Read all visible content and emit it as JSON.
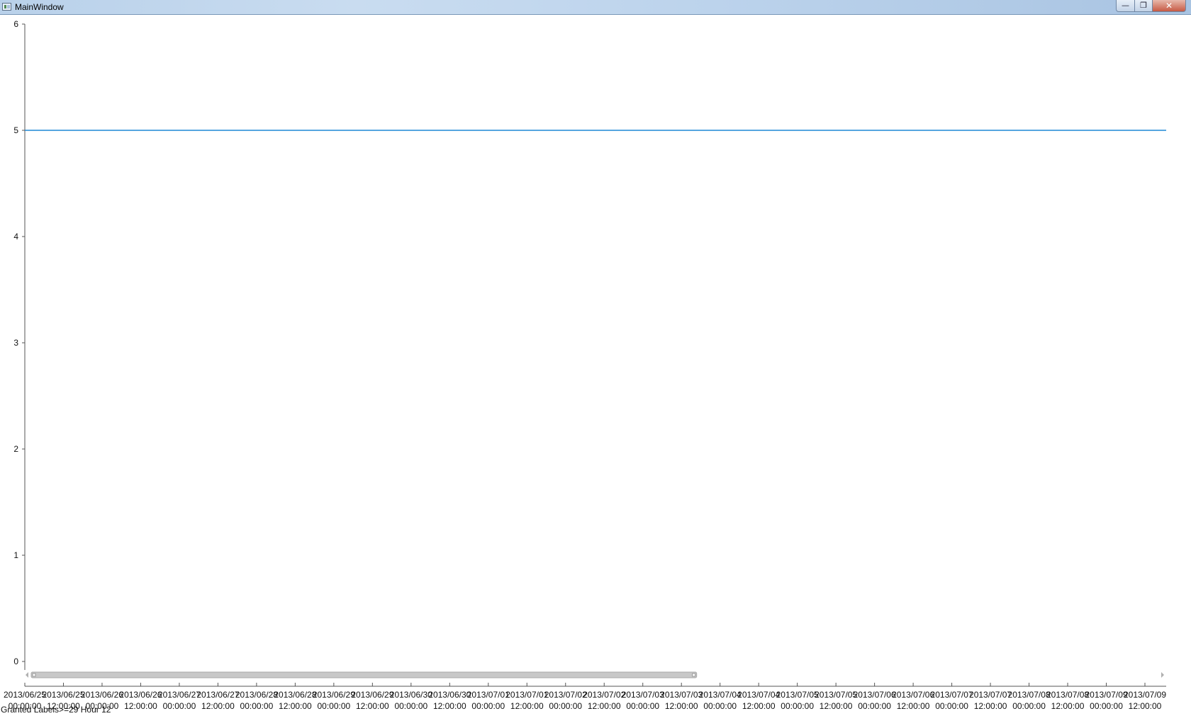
{
  "window": {
    "title": "MainWindow",
    "minimize_glyph": "—",
    "maximize_glyph": "❐",
    "close_glyph": "✕"
  },
  "status_text": "Granted Labels>=29 Hour 12",
  "colors": {
    "series": "#1e88d6",
    "axis": "#555555",
    "scrollbar_thumb": "#c8c8c8"
  },
  "scrollbar": {
    "thumb_start_fraction": 0.0,
    "thumb_end_fraction": 0.59
  },
  "chart_data": {
    "type": "line",
    "title": "",
    "xlabel": "",
    "ylabel": "",
    "ylim": [
      0,
      6
    ],
    "yticks": [
      0,
      1,
      2,
      3,
      4,
      5,
      6
    ],
    "x_ticks": [
      [
        "2013/06/25",
        "00:00:00"
      ],
      [
        "2013/06/25",
        "12:00:00"
      ],
      [
        "2013/06/26",
        "00:00:00"
      ],
      [
        "2013/06/26",
        "12:00:00"
      ],
      [
        "2013/06/27",
        "00:00:00"
      ],
      [
        "2013/06/27",
        "12:00:00"
      ],
      [
        "2013/06/28",
        "00:00:00"
      ],
      [
        "2013/06/28",
        "12:00:00"
      ],
      [
        "2013/06/29",
        "00:00:00"
      ],
      [
        "2013/06/29",
        "12:00:00"
      ],
      [
        "2013/06/30",
        "00:00:00"
      ],
      [
        "2013/06/30",
        "12:00:00"
      ],
      [
        "2013/07/01",
        "00:00:00"
      ],
      [
        "2013/07/01",
        "12:00:00"
      ],
      [
        "2013/07/02",
        "00:00:00"
      ],
      [
        "2013/07/02",
        "12:00:00"
      ],
      [
        "2013/07/03",
        "00:00:00"
      ],
      [
        "2013/07/03",
        "12:00:00"
      ],
      [
        "2013/07/04",
        "00:00:00"
      ],
      [
        "2013/07/04",
        "12:00:00"
      ],
      [
        "2013/07/05",
        "00:00:00"
      ],
      [
        "2013/07/05",
        "12:00:00"
      ],
      [
        "2013/07/06",
        "00:00:00"
      ],
      [
        "2013/07/06",
        "12:00:00"
      ],
      [
        "2013/07/07",
        "00:00:00"
      ],
      [
        "2013/07/07",
        "12:00:00"
      ],
      [
        "2013/07/08",
        "00:00:00"
      ],
      [
        "2013/07/08",
        "12:00:00"
      ],
      [
        "2013/07/09",
        "00:00:00"
      ],
      [
        "2013/07/09",
        "12:00:00"
      ]
    ],
    "series": [
      {
        "x_start": "2013/06/25 00:00:00",
        "x_end": "2013/07/09 12:00:00",
        "values": [
          5,
          5
        ]
      }
    ],
    "grid": false,
    "legend": "none"
  }
}
